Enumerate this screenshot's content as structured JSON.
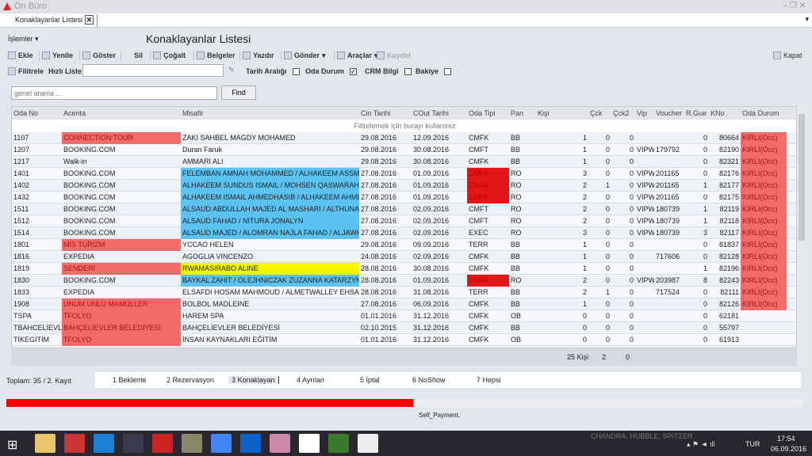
{
  "app_title": "Ön Büro",
  "tab": "Konaklayanlar Listesi",
  "menu": "İşlemler",
  "page_title": "Konaklayanlar Listesi",
  "toolbar": [
    "Ekle",
    "Yenile",
    "Göster",
    "Sil",
    "Çoğalt",
    "Belgeler",
    "Yazdır",
    "Gönder",
    "Araçlar",
    "Kaydet"
  ],
  "close_label": "Kapat",
  "filter": {
    "filtrele": "Filitrele",
    "hizli_liste": "Hızlı Liste",
    "hizli_value": "",
    "tarih": "Tarih Aralığı",
    "tarih_checked": false,
    "oda": "Oda Durum",
    "oda_checked": true,
    "crm": "CRM Bilgi",
    "crm_checked": false,
    "bakiye": "Bakiye",
    "bakiye_checked": false
  },
  "search": {
    "placeholder": "genel arama ...",
    "find": "Find"
  },
  "columns": [
    "Oda No",
    "Acenta",
    "Misafir",
    "Cin Tarihi",
    "COut Tarihi",
    "Oda Tipi",
    "Pan",
    "Kişi",
    "Çck",
    "Çck2",
    "Vip",
    "Voucher",
    "R.Gue",
    "KNo",
    "Oda Durum"
  ],
  "filter_row": "Filtrelemek için burayı kullanınız",
  "rows": [
    [
      "1107",
      "CONNECTION TOUR",
      "ZAKI SAHBEL MAGDY MOHAMED",
      "29.08.2016",
      "12.09.2016",
      "CMFK",
      "BB",
      "",
      "1",
      "0",
      "0",
      "",
      "",
      "0",
      "80664",
      "KIRLI(Occ)",
      "red",
      "",
      "",
      ""
    ],
    [
      "1207",
      "BOOKING.COM",
      "Duran Faruk",
      "29.08.2016",
      "30.08.2016",
      "CMFT",
      "BB",
      "",
      "1",
      "0",
      "0",
      "VIPW",
      "179792",
      "0",
      "82190",
      "KIRLI(Occ)",
      "",
      "",
      "",
      ""
    ],
    [
      "1217",
      "Walk-in",
      "AMMARI ALI",
      "29.08.2016",
      "30.08.2016",
      "CMFK",
      "BB",
      "",
      "1",
      "0",
      "0",
      "",
      "",
      "0",
      "82321",
      "KIRLI(Occ)",
      "",
      "",
      "",
      ""
    ],
    [
      "1401",
      "BOOKING.COM",
      "FELEMBAN AMNAH MOHAMMED / ALHAKEEM ASSMA",
      "27.08.2016",
      "01.09.2016",
      "CMFK",
      "RO",
      "",
      "3",
      "0",
      "0",
      "VIPW",
      "201165",
      "0",
      "82176",
      "KIRLI(Occ)",
      "",
      "blue",
      "dred",
      ""
    ],
    [
      "1402",
      "BOOKING.COM",
      "ALHAKEEM SUNDUS ISMAIL / MOHSEN QASWARAH I",
      "27.08.2016",
      "01.09.2016",
      "CMFK",
      "RO",
      "",
      "2",
      "1",
      "0",
      "VIPW",
      "201165",
      "1",
      "82177",
      "KIRLI(Occ)",
      "",
      "blue",
      "dred",
      ""
    ],
    [
      "1432",
      "BOOKING.COM",
      "ALHAKEEM ISMAIL AHMEDHASIB / ALHAKEEM AHMED",
      "27.08.2016",
      "01.09.2016",
      "CMFK",
      "RO",
      "",
      "2",
      "0",
      "0",
      "VIPW",
      "201165",
      "0",
      "82175",
      "KIRLI(Occ)",
      "",
      "blue",
      "dred",
      ""
    ],
    [
      "1511",
      "BOOKING.COM",
      "ALSAUD ABDULLAH MAJED AL MASHARI / ALTHUNAY",
      "27.08.2016",
      "02.09.2016",
      "CMFT",
      "RO",
      "",
      "2",
      "0",
      "0",
      "VIPW",
      "180739",
      "1",
      "82119",
      "KIRLI(Occ)",
      "",
      "blue",
      "",
      ""
    ],
    [
      "1512",
      "BOOKING.COM",
      "ALSAUD FAHAD / NITURA JONALYN",
      "27.08.2016",
      "02.09.2016",
      "CMFT",
      "RO",
      "",
      "2",
      "0",
      "0",
      "VIPW",
      "180739",
      "1",
      "82118",
      "KIRLI(Occ)",
      "",
      "blue",
      "",
      ""
    ],
    [
      "1514",
      "BOOKING.COM",
      "ALSAUD MAJED / ALOMRAN NAJLA FAHAD / ALJAWHA",
      "27.08.2016",
      "02.09.2016",
      "EXEC",
      "RO",
      "",
      "3",
      "0",
      "0",
      "VIPW",
      "180739",
      "3",
      "82117",
      "KIRLI(Occ)",
      "",
      "blue",
      "",
      ""
    ],
    [
      "1801",
      "MİS TURİZM",
      "YCCAO HELEN",
      "29.08.2016",
      "09.09.2016",
      "TERR",
      "BB",
      "",
      "1",
      "0",
      "0",
      "",
      "",
      "0",
      "81837",
      "KIRLI(Occ)",
      "red",
      "",
      "",
      ""
    ],
    [
      "1816",
      "EXPEDIA",
      "AGOGLIA VINCENZO",
      "24.08.2016",
      "02.09.2016",
      "CMFK",
      "BB",
      "",
      "1",
      "0",
      "0",
      "",
      "717606",
      "0",
      "82128",
      "KIRLI(Occ)",
      "",
      "",
      "",
      ""
    ],
    [
      "1819",
      "SENDERİ",
      "RWAMASIRABO ALINE",
      "28.08.2016",
      "30.08.2016",
      "CMFK",
      "BB",
      "",
      "1",
      "0",
      "0",
      "",
      "",
      "1",
      "82196",
      "KIRLI(Occ)",
      "red",
      "yel",
      "",
      ""
    ],
    [
      "1830",
      "BOOKING.COM",
      "BAYKAL ZAHIT / OLEJHNICZAK ZUZANNA KATARZYNA",
      "28.08.2016",
      "01.09.2016",
      "CMFK",
      "RO",
      "",
      "2",
      "0",
      "0",
      "VIPW",
      "203987",
      "8",
      "82243",
      "KIRLI(Occ)",
      "",
      "blue",
      "dred",
      ""
    ],
    [
      "1833",
      "EXPEDIA",
      "ELSAFDI HOSAM MAHMOUD / ALMETWALLEY EHSAN",
      "28.08.2016",
      "31.08.2016",
      "TERR",
      "BB",
      "",
      "2",
      "1",
      "0",
      "",
      "717524",
      "0",
      "82111",
      "KIRLI(Occ)",
      "",
      "",
      "",
      ""
    ],
    [
      "1908",
      "UNUM UNLU MAMÜLLER",
      "BOLBOL MADLEINE",
      "27.08.2016",
      "06.09.2016",
      "CMFK",
      "BB",
      "",
      "1",
      "0",
      "0",
      "",
      "",
      "0",
      "82126",
      "KIRLI(Occ)",
      "red",
      "",
      "",
      ""
    ],
    [
      "TSPA",
      "TFOLYO",
      " HAREM SPA",
      "01.01.2016",
      "31.12.2016",
      "CMFK",
      "OB",
      "",
      "0",
      "0",
      "0",
      "",
      "",
      "0",
      "62181",
      "",
      "red",
      "",
      "",
      "none"
    ],
    [
      "TBAHCELİEVL",
      "BAHÇELİEVLER BELEDİYESİ",
      "BAHÇELİEVLER BELEDİYESİ",
      "02.10.2015",
      "31.12.2016",
      "CMFK",
      "BB",
      "",
      "0",
      "0",
      "0",
      "",
      "",
      "0",
      "55797",
      "",
      "red",
      "",
      "",
      "none"
    ],
    [
      "TİKEGİTİM",
      "TFOLYO",
      "İNSAN KAYNAKLARI EĞİTİM",
      "01.01.2016",
      "31.12.2016",
      "CMFK",
      "OB",
      "",
      "0",
      "0",
      "0",
      "",
      "",
      "0",
      "61913",
      "",
      "red",
      "",
      "",
      "none"
    ]
  ],
  "footer": {
    "kisi": "25 Kişi",
    "cck": "2",
    "cck2": "0"
  },
  "status": "Toplam: 35 / 2. Kayıt",
  "bottom_tabs": [
    "1 Bekleme",
    "2 Rezervasyon",
    "3 Konaklayan",
    "4 Ayrılan",
    "5 İptal",
    "6 NoShow",
    "7 Hepsi"
  ],
  "active_bottom_tab": "3 Konaklayan",
  "progress_percent": 51,
  "payment_note": "Self_Payment,",
  "taskbar": {
    "watermark": "CHANDRA, HUBBLE, SPITZER",
    "lang": "TUR",
    "time": "17:54",
    "date": "06.09.2016"
  },
  "colors": {
    "agency_highlight": "#f16b6b",
    "room_type_alert": "#e51616",
    "guest_vip": "#5bc2f2",
    "guest_yellow": "#f7f700",
    "progress": "#ff0000"
  }
}
